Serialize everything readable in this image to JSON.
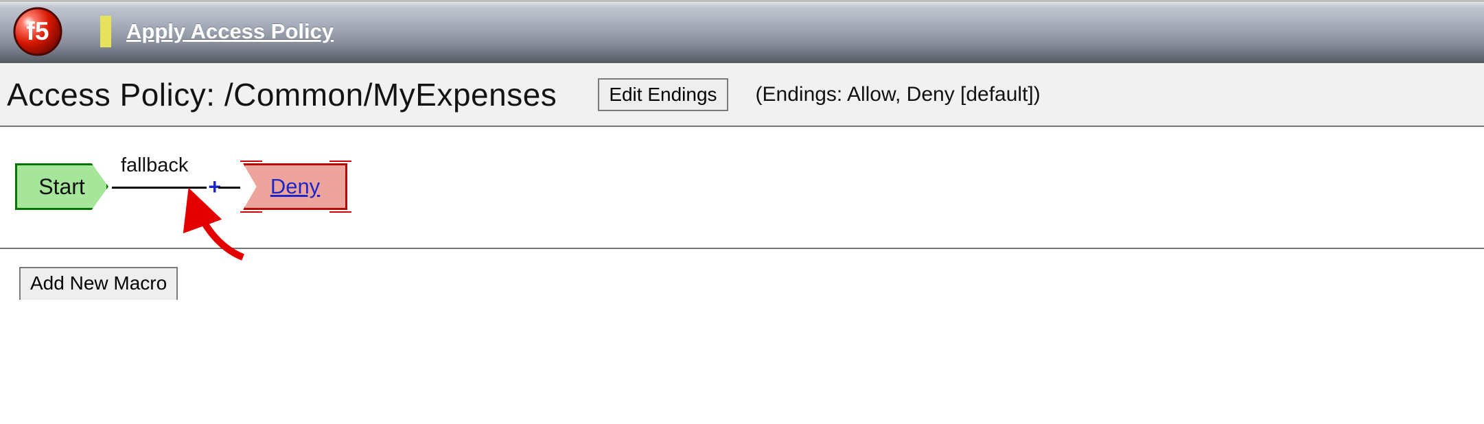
{
  "header": {
    "apply_link_label": "Apply Access Policy"
  },
  "title": {
    "prefix": "Access Policy: ",
    "policy_path": "/Common/MyExpenses",
    "edit_endings_label": "Edit Endings",
    "endings_summary": "(Endings: Allow, Deny [default])"
  },
  "diagram": {
    "start_label": "Start",
    "branch_label": "fallback",
    "add_item_symbol": "+",
    "end_label": "Deny"
  },
  "macro": {
    "add_button_label": "Add New Macro"
  }
}
